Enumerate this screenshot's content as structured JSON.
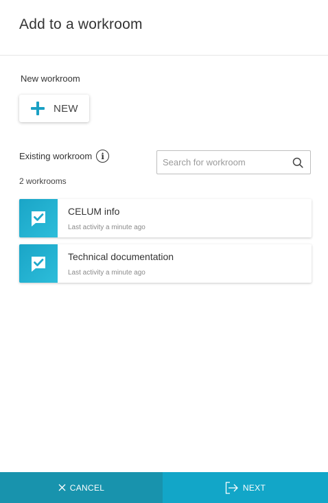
{
  "dialog": {
    "title": "Add to a workroom"
  },
  "new_section": {
    "label": "New workroom",
    "button_label": "NEW",
    "button_icon": "plus-icon",
    "accent": "#1aa0c4"
  },
  "existing_section": {
    "label": "Existing workroom",
    "info_icon": "info-icon",
    "search": {
      "placeholder": "Search for workroom",
      "value": ""
    },
    "count_label": "2 workrooms"
  },
  "workrooms": [
    {
      "name": "CELUM info",
      "activity": "Last activity a minute ago",
      "icon": "workroom-check-icon"
    },
    {
      "name": "Technical documentation",
      "activity": "Last activity a minute ago",
      "icon": "workroom-check-icon"
    }
  ],
  "footer": {
    "cancel_label": "CANCEL",
    "next_label": "NEXT",
    "cancel_color": "#1893ad",
    "next_color": "#12a6c8"
  }
}
